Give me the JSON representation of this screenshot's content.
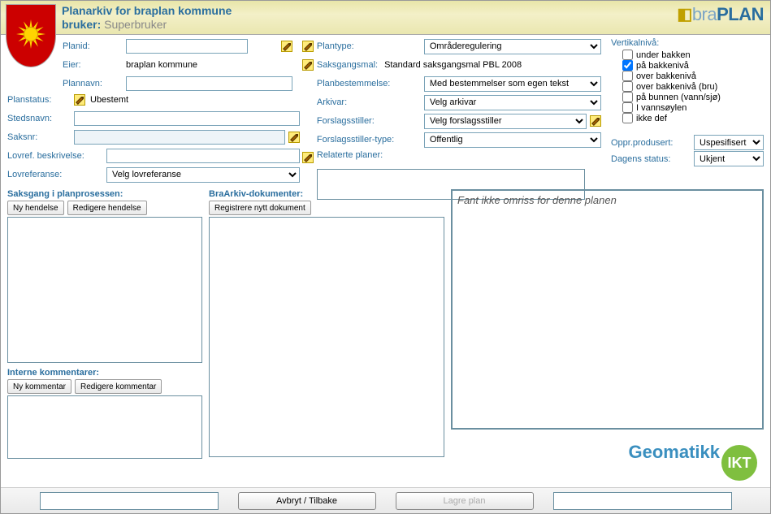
{
  "header": {
    "title": "Planarkiv for braplan kommune",
    "user_label": "bruker:",
    "user": "Superbruker",
    "brand_light": "bra",
    "brand_bold": "PLAN"
  },
  "left": {
    "planid_label": "Planid:",
    "planid": "",
    "eier_label": "Eier:",
    "eier": "braplan kommune",
    "plannavn_label": "Plannavn:",
    "plannavn": "",
    "planstatus_label": "Planstatus:",
    "planstatus": "Ubestemt",
    "stedsnavn_label": "Stedsnavn:",
    "stedsnavn": "",
    "saksnr_label": "Saksnr:",
    "saksnr": "",
    "lovrefb_label": "Lovref. beskrivelse:",
    "lovrefb": "",
    "lovref_label": "Lovreferanse:",
    "lovref_selected": "Velg lovreferanse"
  },
  "mid": {
    "plantype_label": "Plantype:",
    "plantype_selected": "Områderegulering",
    "saksgangsmal_label": "Saksgangsmal:",
    "saksgangsmal": "Standard saksgangsmal PBL 2008",
    "planbest_label": "Planbestemmelse:",
    "planbest_selected": "Med bestemmelser som egen tekst",
    "arkivar_label": "Arkivar:",
    "arkivar_selected": "Velg arkivar",
    "forslag_label": "Forslagsstiller:",
    "forslag_selected": "Velg forslagsstiller",
    "forslagtype_label": "Forslagsstiller-type:",
    "forslagtype_selected": "Offentlig",
    "relaterte_label": "Relaterte planer:"
  },
  "right": {
    "vertikal_label": "Vertikalnivå:",
    "verts": [
      {
        "label": "under bakken",
        "checked": false
      },
      {
        "label": "på bakkenivå",
        "checked": true
      },
      {
        "label": "over bakkenivå",
        "checked": false
      },
      {
        "label": "over bakkenivå (bru)",
        "checked": false
      },
      {
        "label": "på bunnen (vann/sjø)",
        "checked": false
      },
      {
        "label": "I vannsøylen",
        "checked": false
      },
      {
        "label": "ikke def",
        "checked": false
      }
    ],
    "oppr_label": "Oppr.produsert:",
    "oppr_selected": "Uspesifisert",
    "dagens_label": "Dagens status:",
    "dagens_selected": "Ukjent"
  },
  "sections": {
    "saksgang_title": "Saksgang i planprosessen:",
    "ny_hendelse": "Ny hendelse",
    "redigere_hendelse": "Redigere hendelse",
    "interne_title": "Interne kommentarer:",
    "ny_kommentar": "Ny kommentar",
    "redigere_kommentar": "Redigere kommentar",
    "braarkiv_title": "BraArkiv-dokumenter:",
    "registrere": "Registrere nytt dokument",
    "map_msg": "Fant ikke omriss for denne planen"
  },
  "footer": {
    "avbryt": "Avbryt / Tilbake",
    "lagre": "Lagre plan",
    "brand": "Geomatikk",
    "brand_badge": "IKT"
  }
}
